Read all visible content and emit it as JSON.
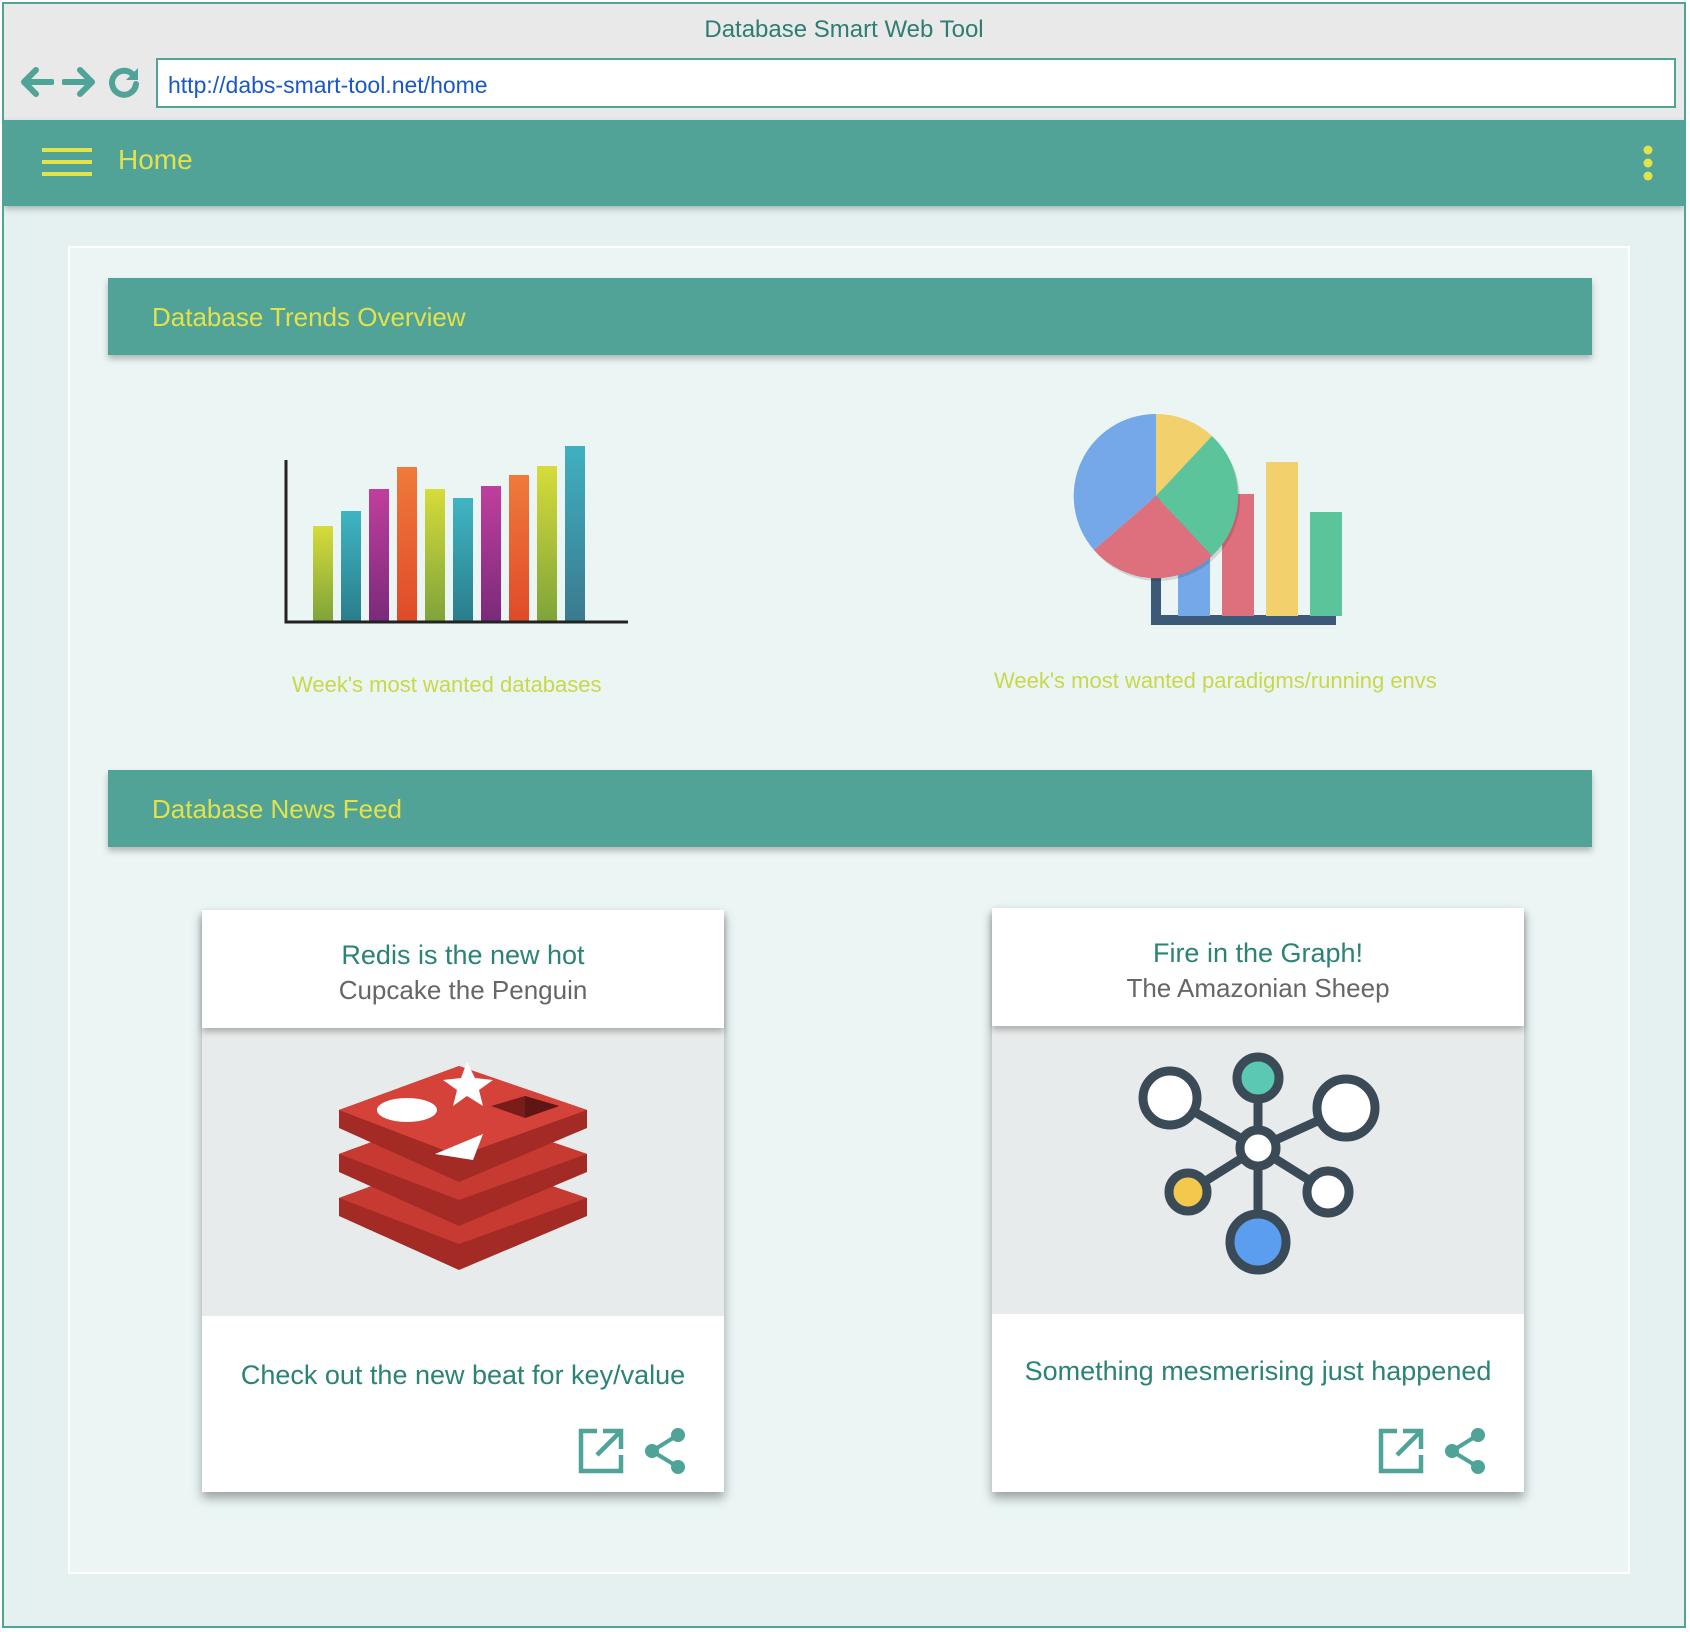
{
  "window": {
    "title": "Database Smart Web Tool"
  },
  "browser": {
    "url": "http://dabs-smart-tool.net/home"
  },
  "appbar": {
    "title": "Home"
  },
  "trends": {
    "header": "Database Trends Overview",
    "charts": [
      {
        "caption": "Week's most wanted databases",
        "icon": "bar-chart-illustration"
      },
      {
        "caption": "Week's most wanted paradigms/running envs",
        "icon": "pie-and-bar-chart-illustration"
      }
    ]
  },
  "news": {
    "header": "Database News Feed",
    "cards": [
      {
        "title": "Redis is the new hot",
        "author": "Cupcake the Penguin",
        "text": "Check out the new beat for key/value",
        "image": "redis-logo"
      },
      {
        "title": "Fire in the Graph!",
        "author": "The Amazonian Sheep",
        "text": "Something mesmerising just happened",
        "image": "graph-network-icon"
      }
    ]
  },
  "colors": {
    "primary": "#51a398",
    "accent": "#e3e24a",
    "background": "#e5f1f0",
    "link": "#1a57c9"
  }
}
